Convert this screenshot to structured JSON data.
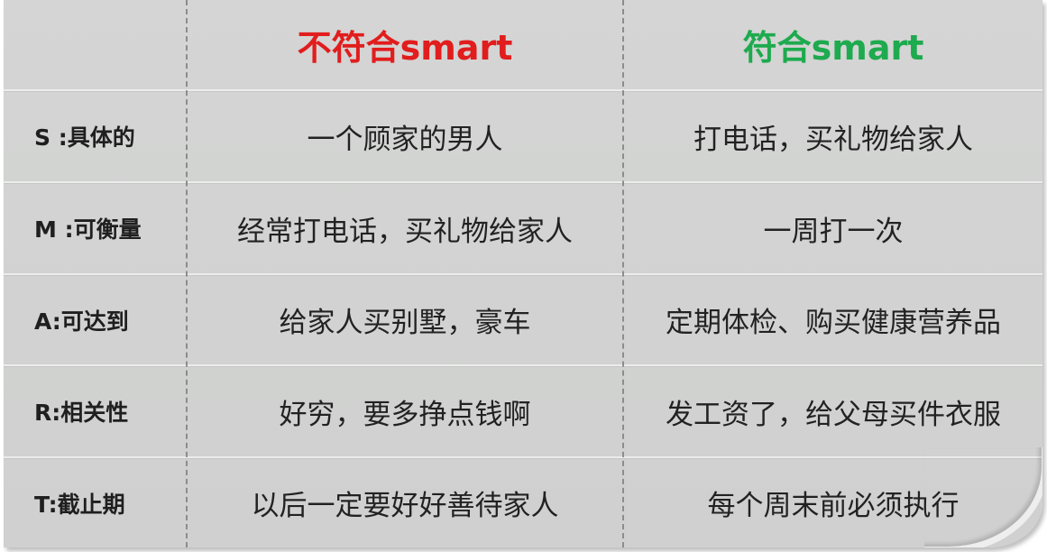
{
  "table": {
    "header": {
      "corner": "",
      "col1": "不符合smart",
      "col2": "符合smart",
      "col1_color": "#e11d1d",
      "col2_color": "#1eaa4e"
    },
    "rows": [
      {
        "label": "S :具体的",
        "not_smart": "一个顾家的男人",
        "smart": "打电话，买礼物给家人"
      },
      {
        "label": "M :可衡量",
        "not_smart": "经常打电话，买礼物给家人",
        "smart": "一周打一次"
      },
      {
        "label": "A:可达到",
        "not_smart": "给家人买别墅，豪车",
        "smart": "定期体检、购买健康营养品"
      },
      {
        "label": "R:相关性",
        "not_smart": "好穷，要多挣点钱啊",
        "smart": "发工资了，给父母买件衣服"
      },
      {
        "label": "T:截止期",
        "not_smart": "以后一定要好好善待家人",
        "smart": "每个周末前必须执行"
      }
    ]
  }
}
